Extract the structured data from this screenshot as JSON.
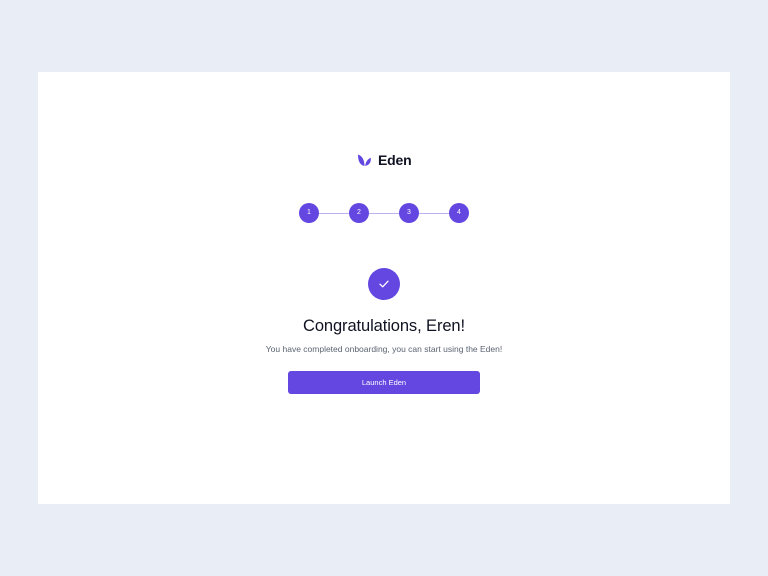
{
  "brand": {
    "name": "Eden",
    "logo_icon": "leaf-icon"
  },
  "stepper": {
    "steps": [
      "1",
      "2",
      "3",
      "4"
    ],
    "current": 4
  },
  "success": {
    "icon": "check-icon",
    "title": "Congratulations, Eren!",
    "message": "You have completed onboarding, you can start using the Eden!"
  },
  "actions": {
    "launch_label": "Launch Eden"
  },
  "colors": {
    "page_background": "#E9EEF6",
    "card_background": "#FFFFFF",
    "accent": "#6347E0",
    "connector": "#B9B2EE",
    "heading_text": "#0F1222",
    "body_text": "#5B6472"
  }
}
